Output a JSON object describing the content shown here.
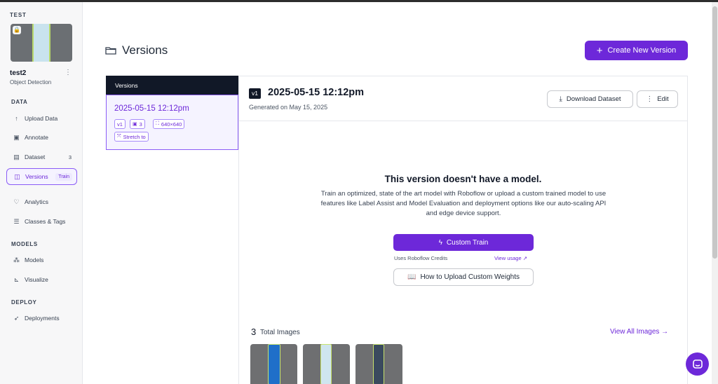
{
  "sidebar": {
    "project_label": "TEST",
    "project_name": "test2",
    "project_type": "Object Detection",
    "sections": {
      "data": "DATA",
      "models": "MODELS",
      "deploy": "DEPLOY"
    },
    "items": [
      {
        "label": "Upload Data",
        "icon": "upload-icon"
      },
      {
        "label": "Annotate",
        "icon": "annotate-icon"
      },
      {
        "label": "Dataset",
        "icon": "dataset-icon",
        "count": "3"
      },
      {
        "label": "Versions",
        "icon": "versions-icon",
        "badge": "Train",
        "active": true
      },
      {
        "label": "Analytics",
        "icon": "analytics-icon"
      },
      {
        "label": "Classes & Tags",
        "icon": "classes-icon"
      },
      {
        "label": "Models",
        "icon": "models-icon"
      },
      {
        "label": "Visualize",
        "icon": "visualize-icon"
      },
      {
        "label": "Deployments",
        "icon": "rocket-icon"
      }
    ]
  },
  "header": {
    "title": "Versions",
    "create_button": "Create New Version"
  },
  "versions_list": {
    "header": "Versions",
    "items": [
      {
        "title": "2025-05-15 12:12pm",
        "version": "v1",
        "image_count": "3",
        "size": "640×640",
        "preprocess": "Stretch to"
      }
    ]
  },
  "version_detail": {
    "badge": "v1",
    "title": "2025-05-15 12:12pm",
    "generated": "Generated on May 15, 2025",
    "download_button": "Download Dataset",
    "edit_button": "Edit",
    "empty_title": "This version doesn't have a model.",
    "empty_description": "Train an optimized, state of the art model with Roboflow or upload a custom trained model to use features like Label Assist and Model Evaluation and deployment options like our auto-scaling API and edge device support.",
    "custom_train_button": "Custom Train",
    "credits_note": "Uses Roboflow Credits",
    "view_usage_link": "View usage ↗",
    "upload_weights_button": "How to Upload Custom Weights",
    "images_count": "3",
    "images_label": "Total Images",
    "view_all_link": "View All Images →"
  },
  "colors": {
    "accent": "#6d28d9",
    "accent_light": "#f5f3ff",
    "dark": "#111827"
  }
}
